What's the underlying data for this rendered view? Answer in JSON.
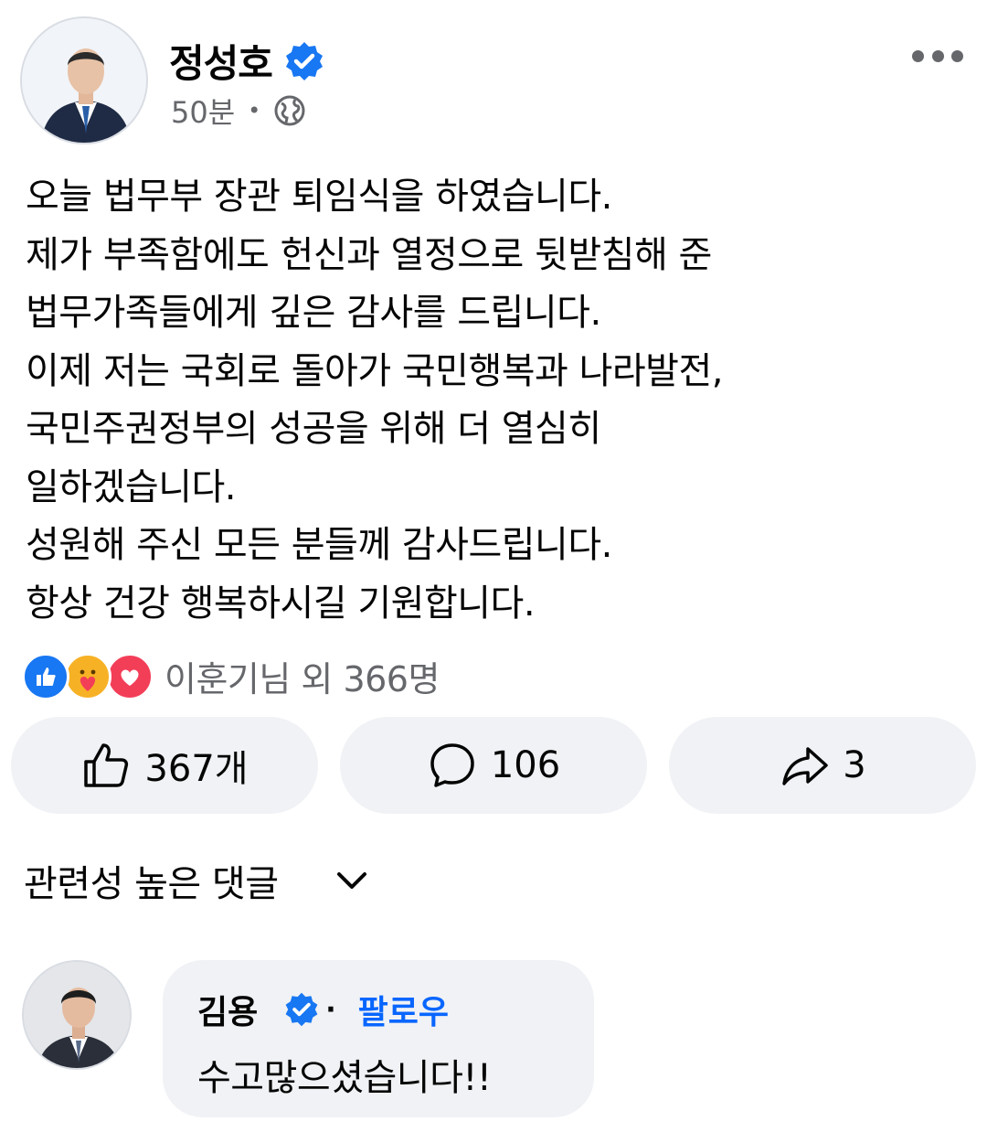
{
  "post": {
    "author": "정성호",
    "time": "50분",
    "lines": [
      "오늘 법무부 장관 퇴임식을 하였습니다.",
      "제가 부족함에도 헌신과 열정으로 뒷받침해 준",
      "법무가족들에게 깊은 감사를 드립니다.",
      "이제 저는 국회로 돌아가 국민행복과 나라발전,",
      "국민주권정부의 성공을 위해 더 열심히",
      "일하겠습니다.",
      "성원해 주신 모든 분들께 감사드립니다.",
      "항상 건강 행복하시길 기원합니다."
    ]
  },
  "reactions": {
    "types": [
      "like-icon",
      "care-icon",
      "love-icon"
    ],
    "summary": "이훈기님 외 366명"
  },
  "actions": {
    "like_count": "367개",
    "comment_count": "106",
    "share_count": "3"
  },
  "comments_section": {
    "sort_label": "관련성 높은 댓글"
  },
  "comment": {
    "author": "김용",
    "dot": "·",
    "follow_label": "팔로우",
    "text": "수고많으셨습니다!!"
  },
  "colors": {
    "accent": "#0866ff",
    "verified": "#1877f2",
    "muted": "#65676b",
    "button_bg": "#f0f2f5"
  }
}
